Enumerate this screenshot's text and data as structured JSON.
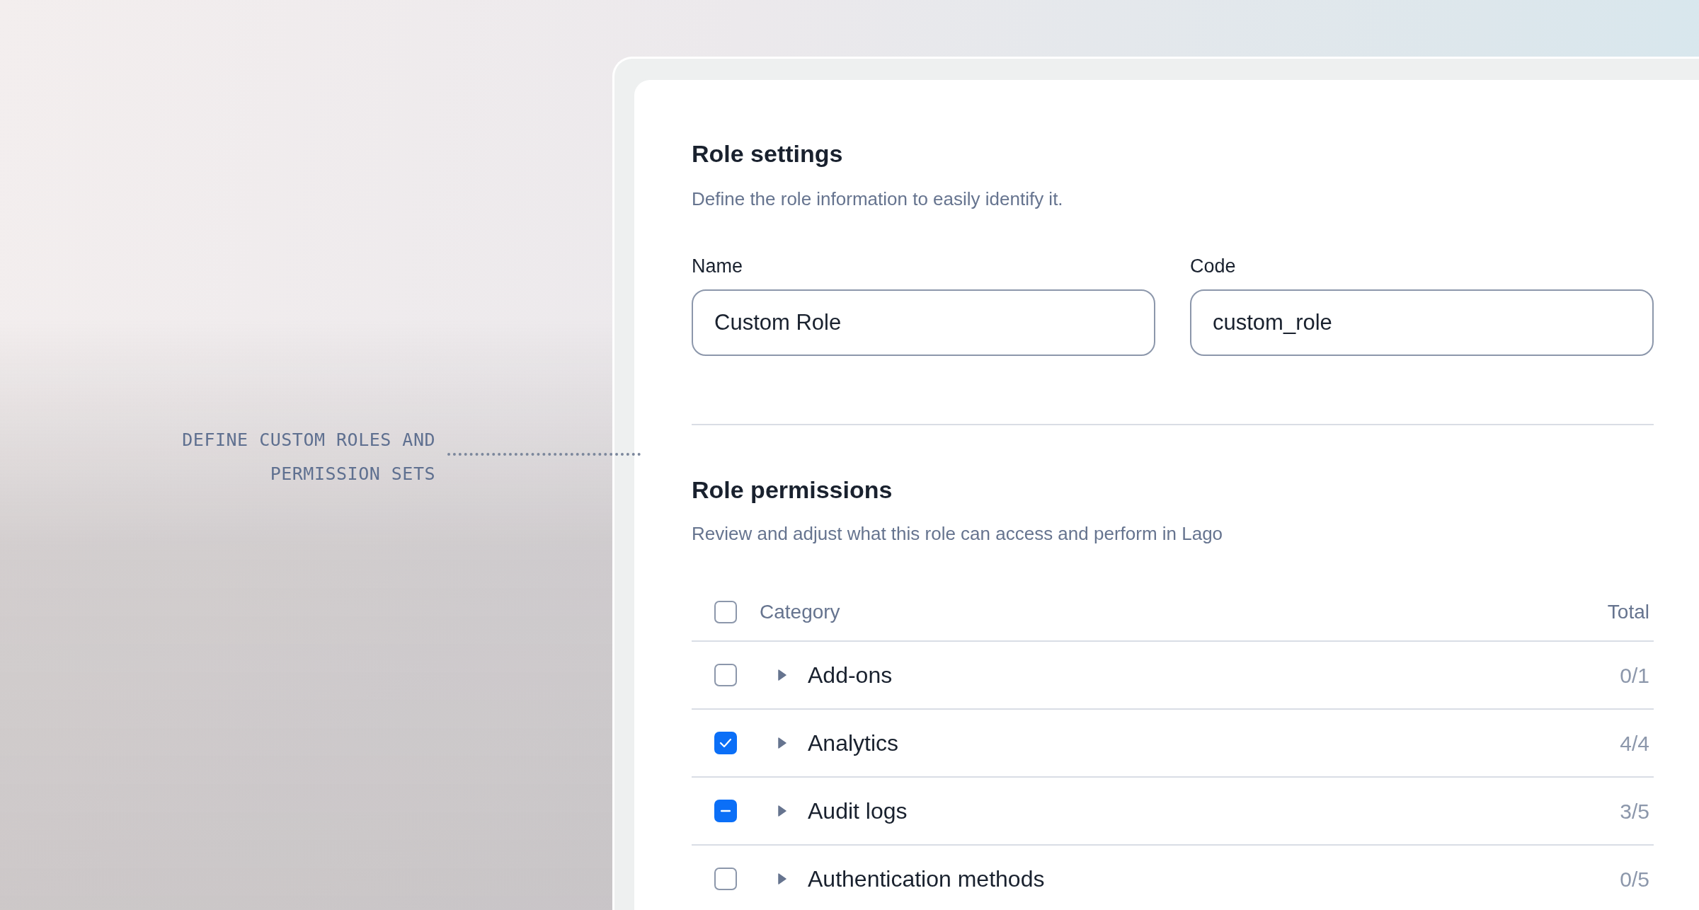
{
  "annotation": {
    "lines": [
      "DEFINE CUSTOM ROLES AND",
      "PERMISSION SETS"
    ]
  },
  "role_settings": {
    "title": "Role settings",
    "subtitle": "Define the role information to easily identify it.",
    "fields": [
      {
        "label": "Name",
        "value": "Custom Role"
      },
      {
        "label": "Code",
        "value": "custom_role"
      }
    ]
  },
  "role_permissions": {
    "title": "Role permissions",
    "subtitle": "Review and adjust what this role can access and perform in Lago",
    "table": {
      "header": {
        "checked": false,
        "indeterminate": false,
        "columns": [
          "Category",
          "Total"
        ]
      },
      "rows": [
        {
          "name": "Add-ons",
          "total": "0/1",
          "checked": false,
          "indeterminate": false,
          "expanded": false
        },
        {
          "name": "Analytics",
          "total": "4/4",
          "checked": true,
          "indeterminate": false,
          "expanded": false
        },
        {
          "name": "Audit logs",
          "total": "3/5",
          "checked": true,
          "indeterminate": true,
          "expanded": false
        },
        {
          "name": "Authentication methods",
          "total": "0/5",
          "checked": false,
          "indeterminate": false,
          "expanded": false
        }
      ]
    }
  }
}
